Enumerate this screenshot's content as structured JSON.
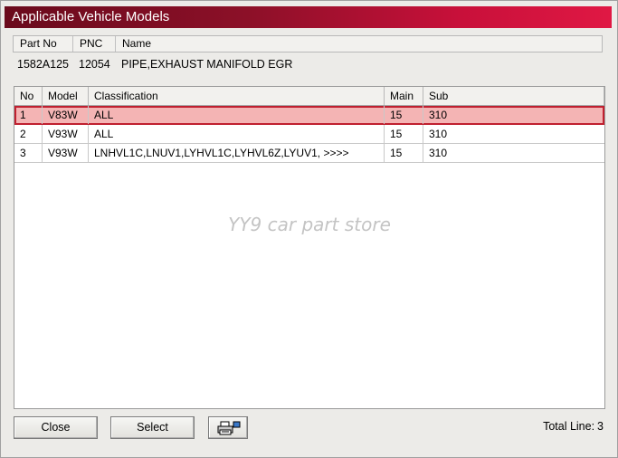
{
  "window": {
    "title": "Applicable Vehicle Models"
  },
  "part": {
    "headers": {
      "part_no": "Part No",
      "pnc": "PNC",
      "name": "Name"
    },
    "part_no": "1582A125",
    "pnc": "12054",
    "name": "PIPE,EXHAUST MANIFOLD EGR"
  },
  "grid": {
    "headers": {
      "no": "No",
      "model": "Model",
      "classification": "Classification",
      "main": "Main",
      "sub": "Sub"
    },
    "rows": [
      {
        "no": "1",
        "model": "V83W",
        "classification": "ALL",
        "main": "15",
        "sub": "310"
      },
      {
        "no": "2",
        "model": "V93W",
        "classification": "ALL",
        "main": "15",
        "sub": "310"
      },
      {
        "no": "3",
        "model": "V93W",
        "classification": "LNHVL1C,LNUV1,LYHVL1C,LYHVL6Z,LYUV1,  >>>>",
        "main": "15",
        "sub": "310"
      }
    ],
    "selected_row": 1,
    "watermark": "YY9 car part store"
  },
  "footer": {
    "close_label": "Close",
    "select_label": "Select",
    "print_icon": "printer-icon",
    "total_label": "Total Line:",
    "total_value": "3"
  },
  "colors": {
    "title_gradient_start": "#6a0a1c",
    "title_gradient_end": "#e01844",
    "selected_row_bg": "#f4b4b4",
    "selected_row_border": "#c02030"
  }
}
